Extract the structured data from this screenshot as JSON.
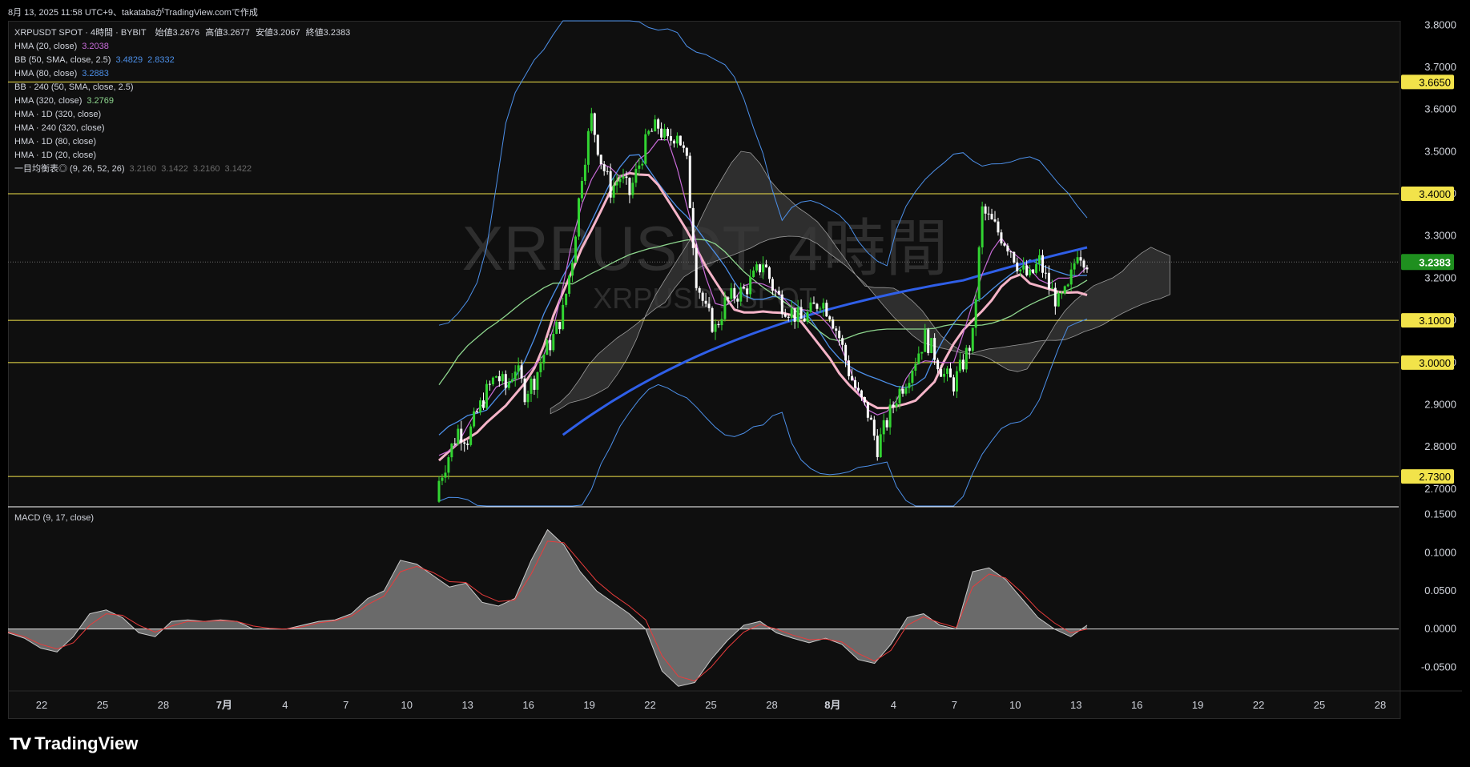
{
  "header": {
    "text": "8月 13, 2025 11:58 UTC+9、takatabaがTradingView.comで作成"
  },
  "watermark": {
    "symbol": "XRPUSDT, 4時間",
    "desc": "XRPUSDT SPOT"
  },
  "legend": {
    "title": {
      "symbol": "XRPUSDT SPOT · 4時間 · BYBIT",
      "open_label": "始値",
      "open": "3.2676",
      "high_label": "高値",
      "high": "3.2677",
      "low_label": "安値",
      "low": "3.2067",
      "close_label": "終値",
      "close": "3.2383"
    },
    "rows": [
      {
        "label": "HMA (20, close)",
        "values": [
          "3.2038"
        ],
        "color": "#c86bd8"
      },
      {
        "label": "BB (50, SMA, close, 2.5)",
        "values": [
          "3.4829",
          "2.8332"
        ],
        "color": "#4c8fe8"
      },
      {
        "label": "HMA (80, close)",
        "values": [
          "3.2883"
        ],
        "color": "#4c8fe8"
      },
      {
        "label": "BB · 240 (50, SMA, close, 2.5)",
        "values": [],
        "color": "#d1d4dc"
      },
      {
        "label": "HMA (320, close)",
        "values": [
          "3.2769"
        ],
        "color": "#8ed68e"
      },
      {
        "label": "HMA · 1D (320, close)",
        "values": [],
        "color": "#d1d4dc"
      },
      {
        "label": "HMA · 240 (320, close)",
        "values": [],
        "color": "#d1d4dc"
      },
      {
        "label": "HMA · 1D (80, close)",
        "values": [],
        "color": "#d1d4dc"
      },
      {
        "label": "HMA · 1D (20, close)",
        "values": [],
        "color": "#d1d4dc"
      },
      {
        "label": "一目均衡表◎ (9, 26, 52, 26)",
        "values": [
          "3.2160",
          "3.1422",
          "3.2160",
          "3.1422"
        ],
        "color": "#d1d4dc"
      }
    ]
  },
  "macd": {
    "label": "MACD (9, 17, close)"
  },
  "brand": {
    "name": "TradingView"
  },
  "colors": {
    "up": "#32d432",
    "down": "#ffffff",
    "hline": "#f2e34a",
    "hma20": "#c86bd8",
    "bb": "#4c8fe8",
    "hma80": "#4c8fe8",
    "hma320": "#8ed68e",
    "pink": "#f5b4c8",
    "blue": "#2f5fe8",
    "signal": "#e83c3c",
    "tag_bg": "#f2e34a"
  },
  "chart_data": [
    {
      "type": "candlestick",
      "title": "XRPUSDT SPOT · 4時間 · BYBIT",
      "ylim": [
        2.66,
        3.81
      ],
      "y_ticks": [
        "3.8000",
        "3.7000",
        "3.6000",
        "3.5000",
        "3.4000",
        "3.3000",
        "3.2000",
        "3.1000",
        "3.0000",
        "2.9000",
        "2.8000",
        "2.7000"
      ],
      "x_ticks": [
        "22",
        "25",
        "28",
        "7月",
        "4",
        "7",
        "10",
        "13",
        "16",
        "19",
        "22",
        "25",
        "28",
        "8月",
        "4",
        "7",
        "10",
        "13",
        "16",
        "19",
        "22",
        "25",
        "28"
      ],
      "price_lines": [
        {
          "value": 3.665,
          "label": "3.6650"
        },
        {
          "value": 3.4,
          "label": "3.4000"
        },
        {
          "value": 3.1,
          "label": "3.1000"
        },
        {
          "value": 3.0,
          "label": "3.0000"
        },
        {
          "value": 2.73,
          "label": "2.7300"
        }
      ],
      "last_price": {
        "value": 3.2383,
        "label": "3.2383"
      },
      "closes_approx": [
        2.72,
        2.78,
        2.84,
        2.82,
        2.88,
        2.93,
        2.97,
        2.94,
        2.99,
        2.93,
        2.96,
        3.02,
        3.06,
        3.12,
        3.25,
        3.45,
        3.58,
        3.48,
        3.41,
        3.44,
        3.4,
        3.47,
        3.54,
        3.56,
        3.52,
        3.55,
        3.47,
        3.2,
        3.12,
        3.08,
        3.14,
        3.16,
        3.17,
        3.2,
        3.24,
        3.18,
        3.14,
        3.12,
        3.1,
        3.12,
        3.15,
        3.12,
        3.06,
        2.98,
        2.92,
        2.88,
        2.8,
        2.86,
        2.92,
        2.96,
        3.01,
        3.06,
        3.02,
        2.97,
        2.95,
        3.0,
        3.06,
        3.36,
        3.33,
        3.3,
        3.27,
        3.22,
        3.2,
        3.24,
        3.18,
        3.14,
        3.17,
        3.27,
        3.24
      ],
      "overlays": [
        {
          "name": "HMA (20, close)",
          "last": 3.2038
        },
        {
          "name": "BB upper",
          "last": 3.4829
        },
        {
          "name": "BB lower",
          "last": 2.8332
        },
        {
          "name": "HMA (80, close)",
          "last": 3.2883
        },
        {
          "name": "HMA (320, close)",
          "last": 3.2769
        },
        {
          "name": "Ichimoku",
          "values": [
            3.216,
            3.1422,
            3.216,
            3.1422
          ]
        }
      ]
    },
    {
      "type": "area",
      "title": "MACD (9, 17, close)",
      "ylim": [
        -0.08,
        0.16
      ],
      "y_ticks": [
        "0.1500",
        "0.1000",
        "0.0500",
        "0.0000",
        "-0.0500"
      ],
      "macd_approx": [
        -0.005,
        -0.012,
        -0.025,
        -0.03,
        -0.01,
        0.02,
        0.025,
        0.015,
        -0.005,
        -0.01,
        0.01,
        0.012,
        0.01,
        0.012,
        0.01,
        0.0,
        0.0,
        0.0,
        0.005,
        0.01,
        0.012,
        0.02,
        0.04,
        0.05,
        0.09,
        0.085,
        0.07,
        0.055,
        0.06,
        0.035,
        0.03,
        0.04,
        0.09,
        0.13,
        0.11,
        0.075,
        0.05,
        0.035,
        0.02,
        0.0,
        -0.055,
        -0.075,
        -0.07,
        -0.04,
        -0.015,
        0.005,
        0.01,
        -0.005,
        -0.012,
        -0.018,
        -0.012,
        -0.02,
        -0.04,
        -0.045,
        -0.02,
        0.015,
        0.02,
        0.005,
        0.0,
        0.075,
        0.08,
        0.065,
        0.04,
        0.015,
        0.0,
        -0.01,
        0.005
      ],
      "signal_approx": [
        -0.004,
        -0.01,
        -0.02,
        -0.026,
        -0.018,
        0.005,
        0.02,
        0.018,
        0.005,
        -0.004,
        0.004,
        0.01,
        0.01,
        0.011,
        0.01,
        0.004,
        0.001,
        0.0,
        0.003,
        0.008,
        0.011,
        0.017,
        0.032,
        0.043,
        0.075,
        0.082,
        0.074,
        0.062,
        0.061,
        0.045,
        0.036,
        0.038,
        0.072,
        0.115,
        0.113,
        0.088,
        0.063,
        0.045,
        0.03,
        0.012,
        -0.035,
        -0.062,
        -0.068,
        -0.05,
        -0.025,
        -0.004,
        0.006,
        0.0,
        -0.008,
        -0.014,
        -0.013,
        -0.017,
        -0.032,
        -0.042,
        -0.028,
        0.005,
        0.016,
        0.008,
        0.002,
        0.055,
        0.072,
        0.067,
        0.048,
        0.025,
        0.008,
        -0.005,
        0.0
      ]
    }
  ]
}
